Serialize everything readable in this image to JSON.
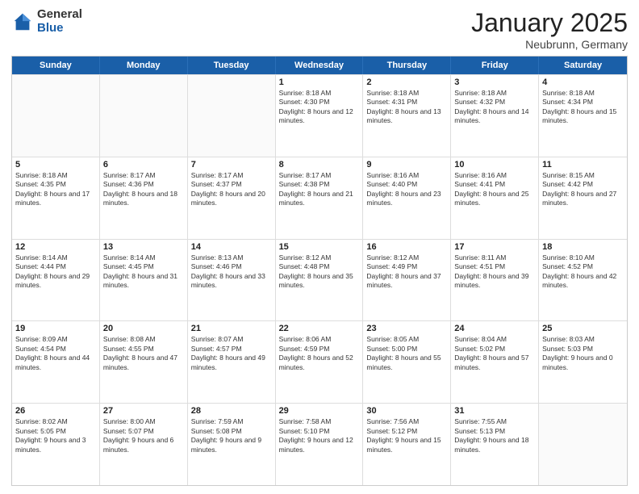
{
  "logo": {
    "general": "General",
    "blue": "Blue"
  },
  "title": "January 2025",
  "location": "Neubrunn, Germany",
  "header_days": [
    "Sunday",
    "Monday",
    "Tuesday",
    "Wednesday",
    "Thursday",
    "Friday",
    "Saturday"
  ],
  "weeks": [
    [
      {
        "day": "",
        "sunrise": "",
        "sunset": "",
        "daylight": ""
      },
      {
        "day": "",
        "sunrise": "",
        "sunset": "",
        "daylight": ""
      },
      {
        "day": "",
        "sunrise": "",
        "sunset": "",
        "daylight": ""
      },
      {
        "day": "1",
        "sunrise": "Sunrise: 8:18 AM",
        "sunset": "Sunset: 4:30 PM",
        "daylight": "Daylight: 8 hours and 12 minutes."
      },
      {
        "day": "2",
        "sunrise": "Sunrise: 8:18 AM",
        "sunset": "Sunset: 4:31 PM",
        "daylight": "Daylight: 8 hours and 13 minutes."
      },
      {
        "day": "3",
        "sunrise": "Sunrise: 8:18 AM",
        "sunset": "Sunset: 4:32 PM",
        "daylight": "Daylight: 8 hours and 14 minutes."
      },
      {
        "day": "4",
        "sunrise": "Sunrise: 8:18 AM",
        "sunset": "Sunset: 4:34 PM",
        "daylight": "Daylight: 8 hours and 15 minutes."
      }
    ],
    [
      {
        "day": "5",
        "sunrise": "Sunrise: 8:18 AM",
        "sunset": "Sunset: 4:35 PM",
        "daylight": "Daylight: 8 hours and 17 minutes."
      },
      {
        "day": "6",
        "sunrise": "Sunrise: 8:17 AM",
        "sunset": "Sunset: 4:36 PM",
        "daylight": "Daylight: 8 hours and 18 minutes."
      },
      {
        "day": "7",
        "sunrise": "Sunrise: 8:17 AM",
        "sunset": "Sunset: 4:37 PM",
        "daylight": "Daylight: 8 hours and 20 minutes."
      },
      {
        "day": "8",
        "sunrise": "Sunrise: 8:17 AM",
        "sunset": "Sunset: 4:38 PM",
        "daylight": "Daylight: 8 hours and 21 minutes."
      },
      {
        "day": "9",
        "sunrise": "Sunrise: 8:16 AM",
        "sunset": "Sunset: 4:40 PM",
        "daylight": "Daylight: 8 hours and 23 minutes."
      },
      {
        "day": "10",
        "sunrise": "Sunrise: 8:16 AM",
        "sunset": "Sunset: 4:41 PM",
        "daylight": "Daylight: 8 hours and 25 minutes."
      },
      {
        "day": "11",
        "sunrise": "Sunrise: 8:15 AM",
        "sunset": "Sunset: 4:42 PM",
        "daylight": "Daylight: 8 hours and 27 minutes."
      }
    ],
    [
      {
        "day": "12",
        "sunrise": "Sunrise: 8:14 AM",
        "sunset": "Sunset: 4:44 PM",
        "daylight": "Daylight: 8 hours and 29 minutes."
      },
      {
        "day": "13",
        "sunrise": "Sunrise: 8:14 AM",
        "sunset": "Sunset: 4:45 PM",
        "daylight": "Daylight: 8 hours and 31 minutes."
      },
      {
        "day": "14",
        "sunrise": "Sunrise: 8:13 AM",
        "sunset": "Sunset: 4:46 PM",
        "daylight": "Daylight: 8 hours and 33 minutes."
      },
      {
        "day": "15",
        "sunrise": "Sunrise: 8:12 AM",
        "sunset": "Sunset: 4:48 PM",
        "daylight": "Daylight: 8 hours and 35 minutes."
      },
      {
        "day": "16",
        "sunrise": "Sunrise: 8:12 AM",
        "sunset": "Sunset: 4:49 PM",
        "daylight": "Daylight: 8 hours and 37 minutes."
      },
      {
        "day": "17",
        "sunrise": "Sunrise: 8:11 AM",
        "sunset": "Sunset: 4:51 PM",
        "daylight": "Daylight: 8 hours and 39 minutes."
      },
      {
        "day": "18",
        "sunrise": "Sunrise: 8:10 AM",
        "sunset": "Sunset: 4:52 PM",
        "daylight": "Daylight: 8 hours and 42 minutes."
      }
    ],
    [
      {
        "day": "19",
        "sunrise": "Sunrise: 8:09 AM",
        "sunset": "Sunset: 4:54 PM",
        "daylight": "Daylight: 8 hours and 44 minutes."
      },
      {
        "day": "20",
        "sunrise": "Sunrise: 8:08 AM",
        "sunset": "Sunset: 4:55 PM",
        "daylight": "Daylight: 8 hours and 47 minutes."
      },
      {
        "day": "21",
        "sunrise": "Sunrise: 8:07 AM",
        "sunset": "Sunset: 4:57 PM",
        "daylight": "Daylight: 8 hours and 49 minutes."
      },
      {
        "day": "22",
        "sunrise": "Sunrise: 8:06 AM",
        "sunset": "Sunset: 4:59 PM",
        "daylight": "Daylight: 8 hours and 52 minutes."
      },
      {
        "day": "23",
        "sunrise": "Sunrise: 8:05 AM",
        "sunset": "Sunset: 5:00 PM",
        "daylight": "Daylight: 8 hours and 55 minutes."
      },
      {
        "day": "24",
        "sunrise": "Sunrise: 8:04 AM",
        "sunset": "Sunset: 5:02 PM",
        "daylight": "Daylight: 8 hours and 57 minutes."
      },
      {
        "day": "25",
        "sunrise": "Sunrise: 8:03 AM",
        "sunset": "Sunset: 5:03 PM",
        "daylight": "Daylight: 9 hours and 0 minutes."
      }
    ],
    [
      {
        "day": "26",
        "sunrise": "Sunrise: 8:02 AM",
        "sunset": "Sunset: 5:05 PM",
        "daylight": "Daylight: 9 hours and 3 minutes."
      },
      {
        "day": "27",
        "sunrise": "Sunrise: 8:00 AM",
        "sunset": "Sunset: 5:07 PM",
        "daylight": "Daylight: 9 hours and 6 minutes."
      },
      {
        "day": "28",
        "sunrise": "Sunrise: 7:59 AM",
        "sunset": "Sunset: 5:08 PM",
        "daylight": "Daylight: 9 hours and 9 minutes."
      },
      {
        "day": "29",
        "sunrise": "Sunrise: 7:58 AM",
        "sunset": "Sunset: 5:10 PM",
        "daylight": "Daylight: 9 hours and 12 minutes."
      },
      {
        "day": "30",
        "sunrise": "Sunrise: 7:56 AM",
        "sunset": "Sunset: 5:12 PM",
        "daylight": "Daylight: 9 hours and 15 minutes."
      },
      {
        "day": "31",
        "sunrise": "Sunrise: 7:55 AM",
        "sunset": "Sunset: 5:13 PM",
        "daylight": "Daylight: 9 hours and 18 minutes."
      },
      {
        "day": "",
        "sunrise": "",
        "sunset": "",
        "daylight": ""
      }
    ]
  ]
}
